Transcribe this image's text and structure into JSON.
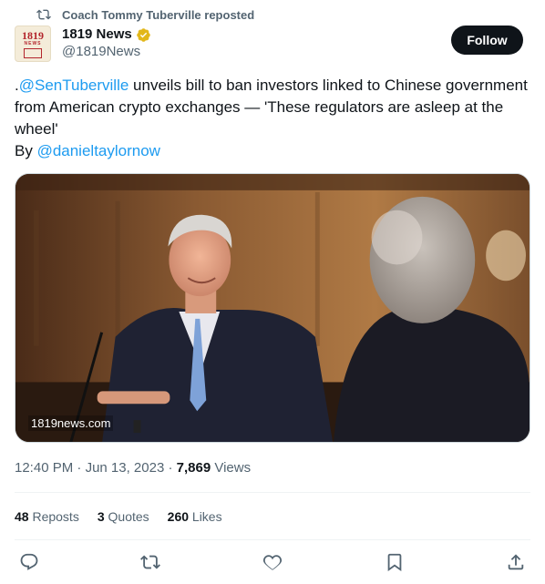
{
  "repost": {
    "text": "Coach Tommy Tuberville reposted"
  },
  "author": {
    "avatar_text": "1819",
    "avatar_sub": "NEWS",
    "name": "1819 News",
    "handle": "@1819News",
    "verified_color": "#e2b719"
  },
  "follow_label": "Follow",
  "tweet": {
    "prefix": ".",
    "mention": "@SenTuberville",
    "body": " unveils bill to ban investors linked to Chinese government from American crypto exchanges — 'These regulators are asleep at the wheel'",
    "by_label": "By ",
    "by_mention": "@danieltaylornow"
  },
  "media": {
    "watermark": "1819news.com"
  },
  "meta": {
    "time": "12:40 PM",
    "sep1": " · ",
    "date": "Jun 13, 2023",
    "sep2": " · ",
    "views_count": "7,869",
    "views_label": " Views"
  },
  "stats": [
    {
      "count": "48",
      "label": " Reposts"
    },
    {
      "count": "3",
      "label": " Quotes"
    },
    {
      "count": "260",
      "label": " Likes"
    }
  ],
  "colors": {
    "link": "#1d9bf0",
    "muted": "#536471",
    "text": "#0f1419"
  },
  "icons": [
    "repost-icon",
    "verified-badge-icon",
    "reply-icon",
    "retweet-icon",
    "like-icon",
    "bookmark-icon",
    "share-icon"
  ]
}
